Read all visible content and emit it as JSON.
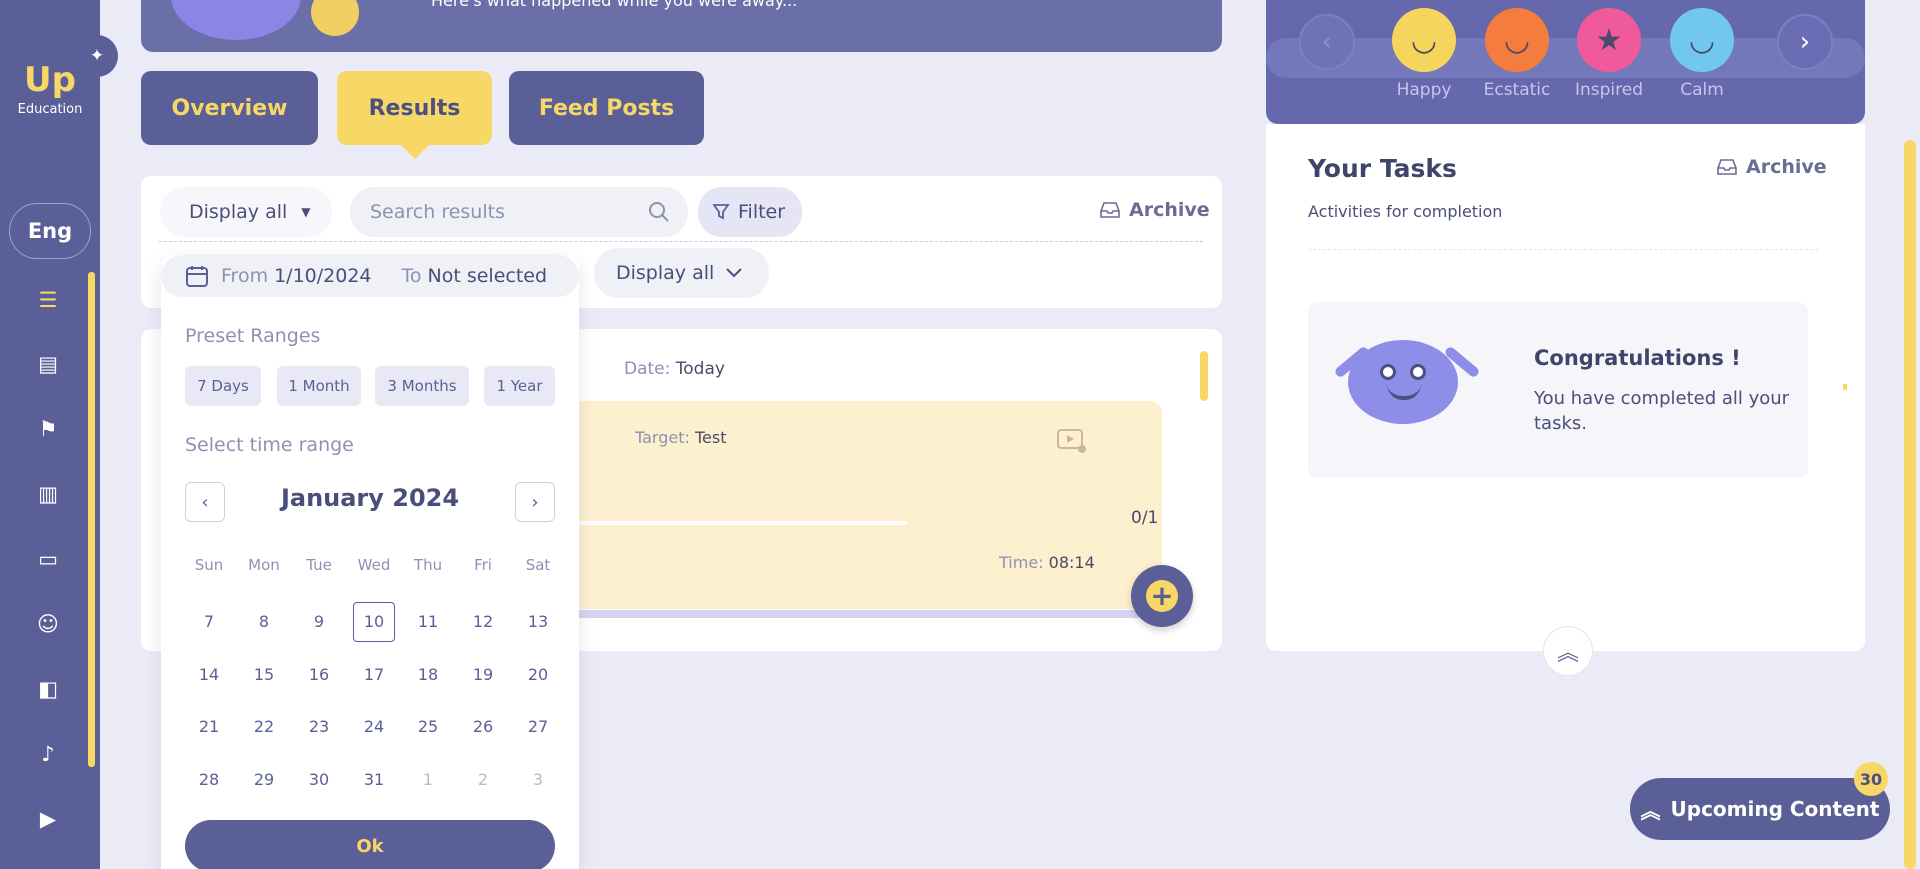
{
  "sidebar": {
    "logo_mark": "Up",
    "logo_name": "Education",
    "lang": "Eng",
    "icons": [
      "menu-icon",
      "news-icon",
      "course-icon",
      "stats-icon",
      "chat-icon",
      "people-icon",
      "panel-icon",
      "bell-icon",
      "video-icon"
    ]
  },
  "hero": {
    "text": "Here's what happened while you were away..."
  },
  "tabs": [
    {
      "label": "Overview",
      "active": false
    },
    {
      "label": "Results",
      "active": true
    },
    {
      "label": "Feed Posts",
      "active": false
    }
  ],
  "filters": {
    "display": "Display all",
    "search_placeholder": "Search results",
    "filter_label": "Filter",
    "archive_label": "Archive",
    "from_label": "From",
    "from_value": "1/10/2024",
    "to_label": "To",
    "to_value": "Not selected",
    "display2": "Display all"
  },
  "result": {
    "date_label": "Date:",
    "date_value": "Today",
    "target_label": "Target:",
    "target_value": "Test",
    "progress": "0/1",
    "time_label": "Time:",
    "time_value": "08:14"
  },
  "datepicker": {
    "preset_title": "Preset Ranges",
    "presets": [
      "7 Days",
      "1 Month",
      "3 Months",
      "1 Year"
    ],
    "range_title": "Select time range",
    "month": "January 2024",
    "weekdays": [
      "Sun",
      "Mon",
      "Tue",
      "Wed",
      "Thu",
      "Fri",
      "Sat"
    ],
    "weeks": [
      [
        "7",
        "8",
        "9",
        "10",
        "11",
        "12",
        "13"
      ],
      [
        "14",
        "15",
        "16",
        "17",
        "18",
        "19",
        "20"
      ],
      [
        "21",
        "22",
        "23",
        "24",
        "25",
        "26",
        "27"
      ],
      [
        "28",
        "29",
        "30",
        "31",
        "1",
        "2",
        "3"
      ]
    ],
    "selected_day": "10",
    "ok_label": "Ok"
  },
  "moods": [
    {
      "label": "Happy",
      "color": "#f6d55c"
    },
    {
      "label": "Ecstatic",
      "color": "#f47c3c"
    },
    {
      "label": "Inspired",
      "color": "#f05a9a"
    },
    {
      "label": "Calm",
      "color": "#72c7f0"
    }
  ],
  "tasks": {
    "title": "Your Tasks",
    "archive": "Archive",
    "subtitle": "Activities for completion",
    "congrats_title": "Congratulations !",
    "congrats_text": "You have completed all your tasks."
  },
  "upcoming": {
    "label": "Upcoming Content",
    "count": "30"
  },
  "colors": {
    "primary": "#5b5f97",
    "accent": "#f7d766",
    "background": "#ebebf7"
  }
}
